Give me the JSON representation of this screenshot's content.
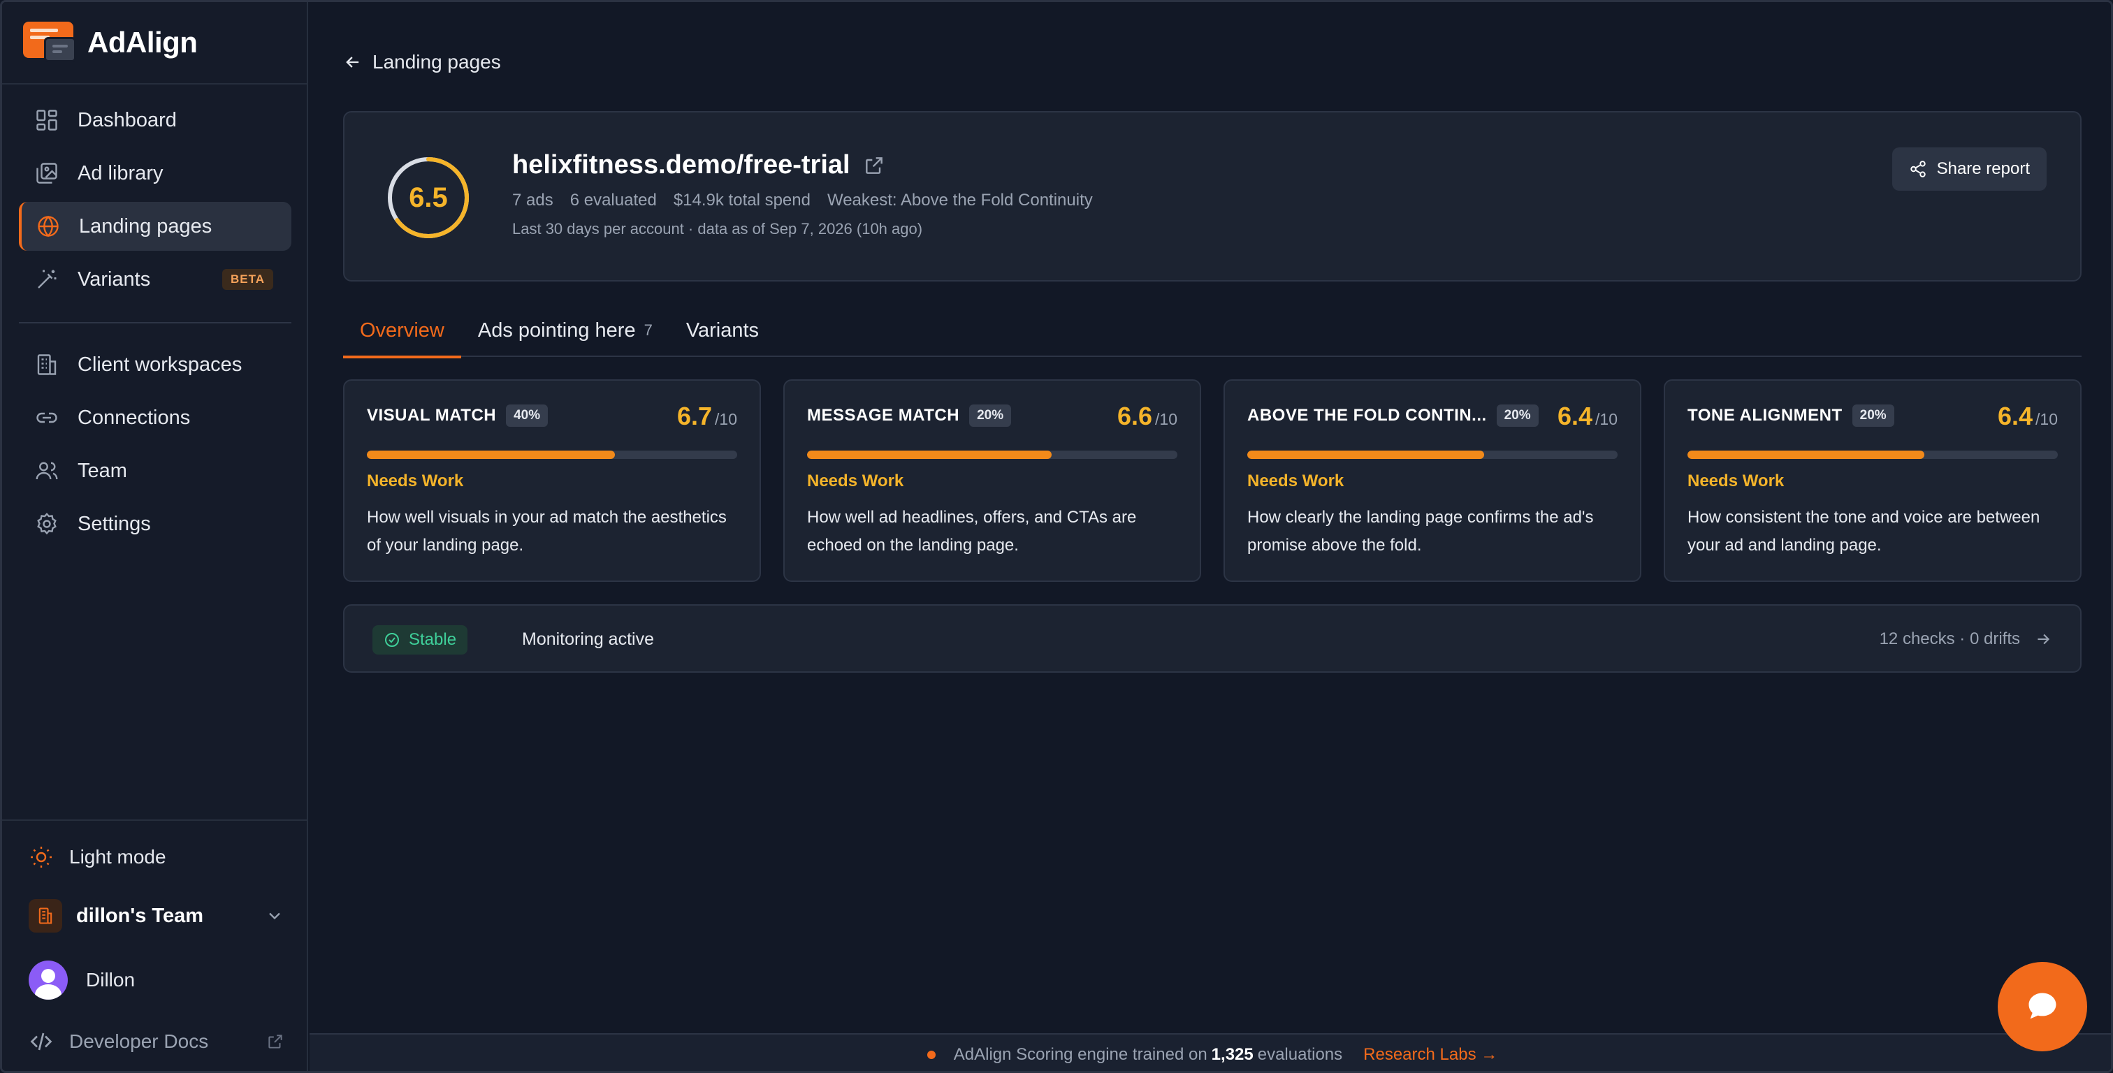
{
  "brand": {
    "name": "AdAlign"
  },
  "sidebar": {
    "nav": [
      {
        "label": "Dashboard",
        "icon": "dashboard-icon"
      },
      {
        "label": "Ad library",
        "icon": "image-library-icon"
      },
      {
        "label": "Landing pages",
        "icon": "globe-icon",
        "active": true
      },
      {
        "label": "Variants",
        "icon": "magic-wand-icon",
        "badge": "BETA"
      }
    ],
    "nav2": [
      {
        "label": "Client workspaces",
        "icon": "building-icon"
      },
      {
        "label": "Connections",
        "icon": "link-icon"
      },
      {
        "label": "Team",
        "icon": "users-icon"
      },
      {
        "label": "Settings",
        "icon": "gear-icon"
      }
    ],
    "light_mode": "Light mode",
    "team_name": "dillon's Team",
    "user_name": "Dillon",
    "developer_docs": "Developer Docs"
  },
  "header": {
    "back_label": "Landing pages",
    "score": "6.5",
    "score_fraction": 0.65,
    "url": "helixfitness.demo/free-trial",
    "meta": [
      "7 ads",
      "6 evaluated",
      "$14.9k total spend",
      "Weakest: Above the Fold Continuity"
    ],
    "subtitle": "Last 30 days per account · data as of Sep 7, 2026 (10h ago)",
    "share_label": "Share report"
  },
  "tabs": [
    {
      "label": "Overview",
      "active": true,
      "count": ""
    },
    {
      "label": "Ads pointing here",
      "count": "7"
    },
    {
      "label": "Variants",
      "count": ""
    }
  ],
  "metrics": [
    {
      "name": "VISUAL MATCH",
      "weight": "40%",
      "score": "6.7",
      "denom": "/10",
      "fill": 0.67,
      "status": "Needs Work",
      "desc": "How well visuals in your ad match the aesthetics of your landing page."
    },
    {
      "name": "MESSAGE MATCH",
      "weight": "20%",
      "score": "6.6",
      "denom": "/10",
      "fill": 0.66,
      "status": "Needs Work",
      "desc": "How well ad headlines, offers, and CTAs are echoed on the landing page."
    },
    {
      "name": "ABOVE THE FOLD CONTIN...",
      "weight": "20%",
      "score": "6.4",
      "denom": "/10",
      "fill": 0.64,
      "status": "Needs Work",
      "desc": "How clearly the landing page confirms the ad's promise above the fold."
    },
    {
      "name": "TONE ALIGNMENT",
      "weight": "20%",
      "score": "6.4",
      "denom": "/10",
      "fill": 0.64,
      "status": "Needs Work",
      "desc": "How consistent the tone and voice are between your ad and landing page."
    }
  ],
  "monitor": {
    "status": "Stable",
    "text": "Monitoring active",
    "summary": "12 checks · 0 drifts"
  },
  "footer": {
    "pre": "AdAlign Scoring engine trained on",
    "count": "1,325",
    "post": "evaluations",
    "link": "Research Labs →"
  },
  "colors": {
    "accent": "#f26a1b",
    "score": "#f5b42a",
    "success": "#3fd09a",
    "background": "#121826",
    "card": "#1c2331"
  }
}
